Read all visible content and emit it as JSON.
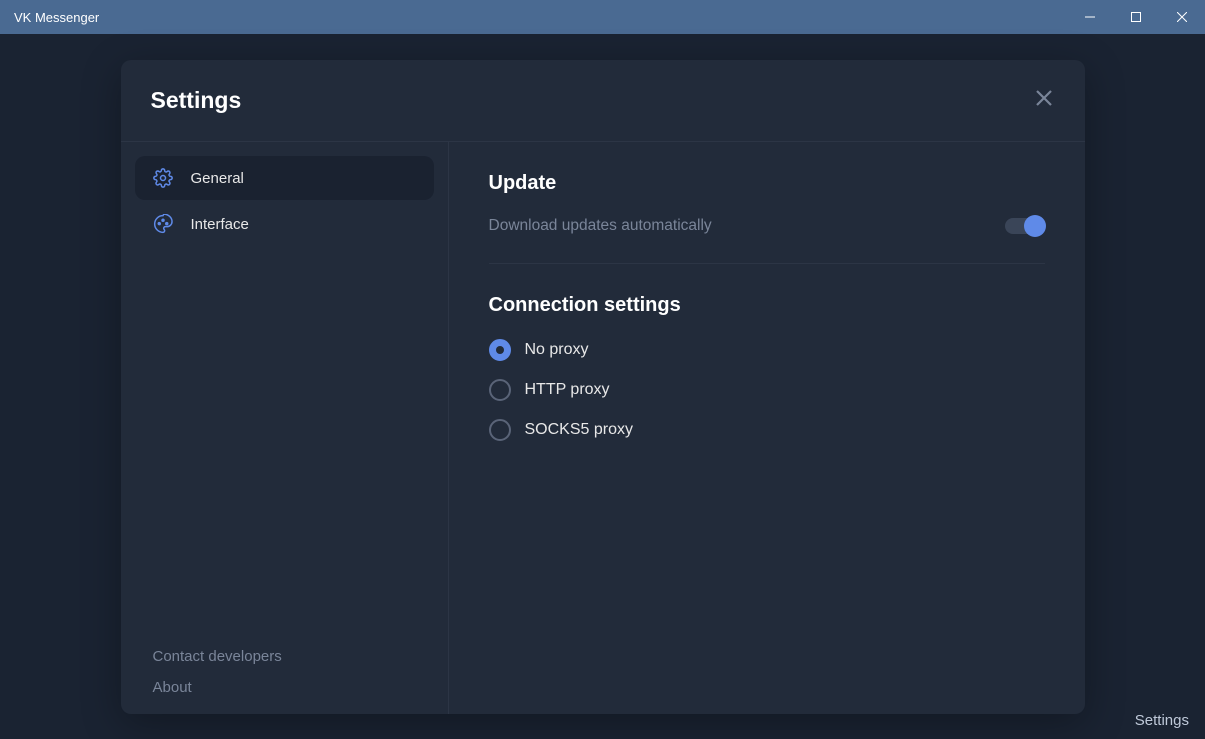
{
  "titlebar": {
    "title": "VK Messenger"
  },
  "modal": {
    "title": "Settings",
    "sidebar": {
      "items": [
        {
          "label": "General",
          "active": true
        },
        {
          "label": "Interface",
          "active": false
        }
      ],
      "footer": {
        "contact": "Contact developers",
        "about": "About"
      }
    },
    "content": {
      "update": {
        "heading": "Update",
        "auto_download_label": "Download updates automatically",
        "auto_download_on": true
      },
      "connection": {
        "heading": "Connection settings",
        "options": [
          {
            "label": "No proxy",
            "selected": true
          },
          {
            "label": "HTTP proxy",
            "selected": false
          },
          {
            "label": "SOCKS5 proxy",
            "selected": false
          }
        ]
      }
    }
  },
  "status": {
    "label": "Settings"
  }
}
